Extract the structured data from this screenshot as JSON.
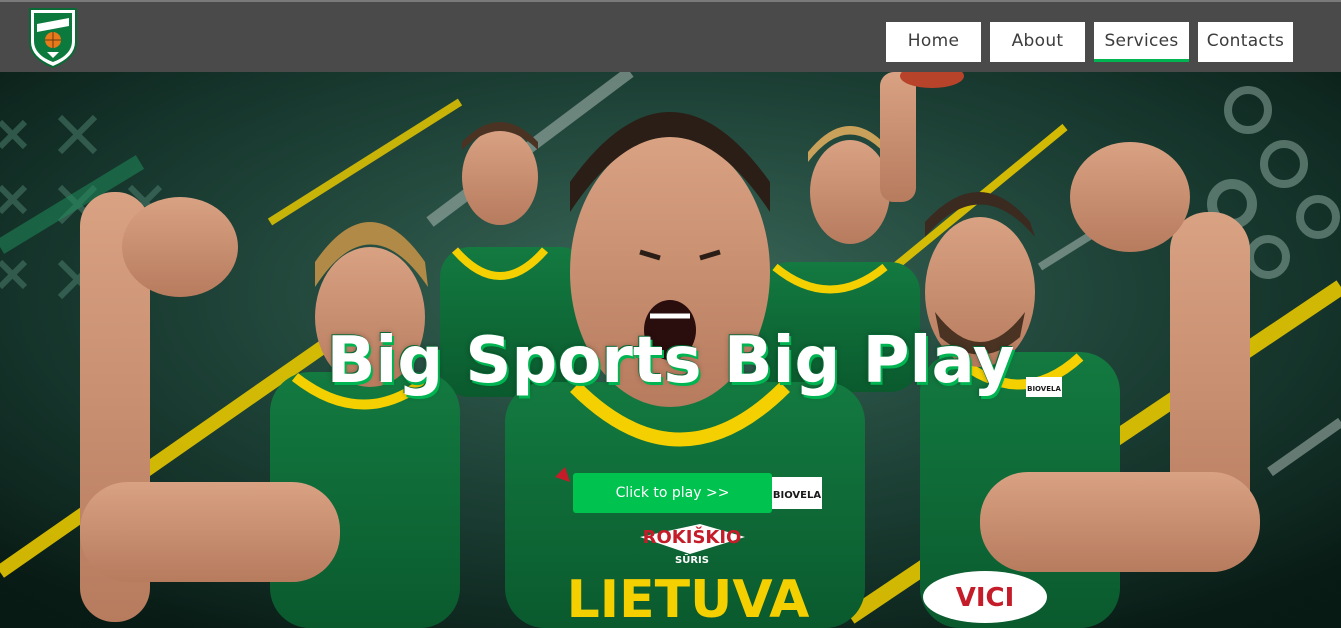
{
  "header": {
    "logo_icon": "team-shield-logo-icon",
    "nav": [
      {
        "label": "Home",
        "active": false
      },
      {
        "label": "About",
        "active": false
      },
      {
        "label": "Services",
        "active": true
      },
      {
        "label": "Contacts",
        "active": false
      }
    ]
  },
  "hero": {
    "title": "Big Sports Big Play",
    "cta_label": "Click to play >>",
    "jersey_text": "LIETUVA",
    "sponsor_text": "ROKIŠKIO",
    "sponsor_sub": "SŪRIS",
    "sponsor_two": "VICI",
    "sponsor_three": "BIOVELA"
  },
  "colors": {
    "topbar": "#4a4a4a",
    "accent_green": "#00b451",
    "button_green": "#00c24f",
    "jersey_green": "#0f6b3a",
    "jersey_yellow": "#f5d000",
    "background_dark": "#0f2a22"
  }
}
